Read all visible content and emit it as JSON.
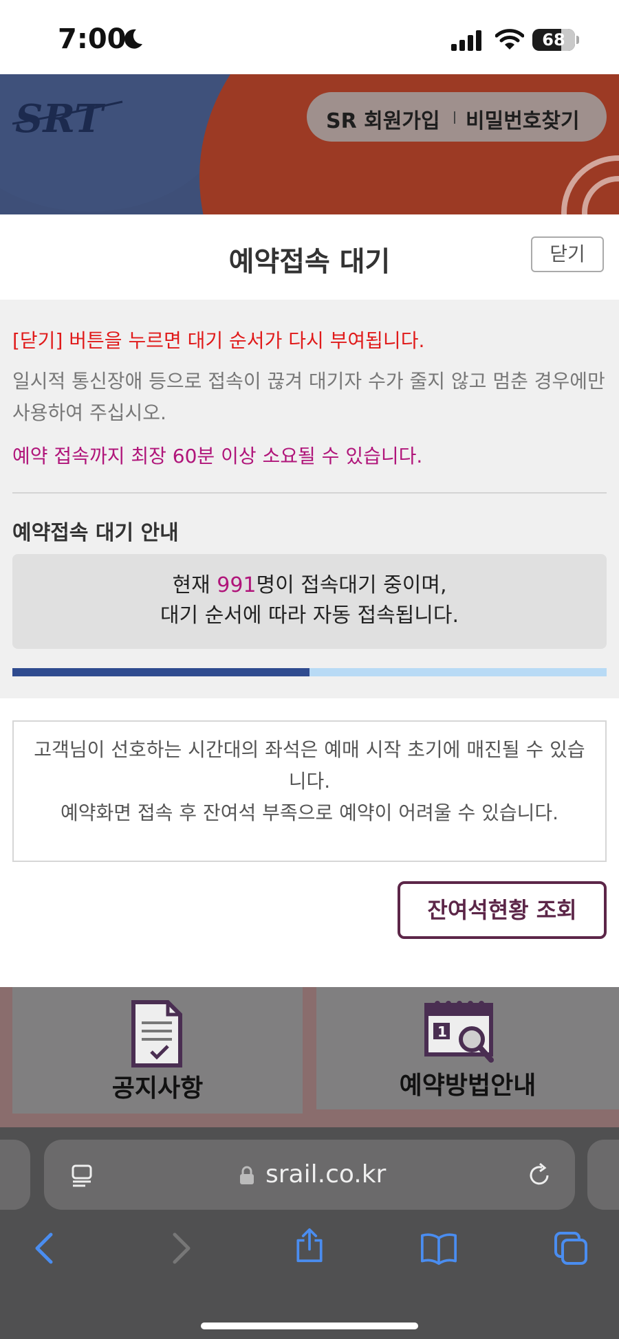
{
  "status_bar": {
    "time": "7:00",
    "battery": "68",
    "battery_level": 0.68,
    "icons": [
      "moon-icon",
      "signal-icon",
      "wifi-icon",
      "battery-icon"
    ]
  },
  "header": {
    "logo_text": "SRT",
    "signup": "SR 회원가입",
    "find_password": "비밀번호찾기"
  },
  "title_bar": {
    "title": "예약접속 대기",
    "close": "닫기"
  },
  "notices": {
    "red": "[닫기] 버튼을 누르면 대기 순서가 다시 부여됩니다.",
    "grey": "일시적 통신장애 등으로 접속이 끊겨 대기자 수가 줄지 않고 멈춘 경우에만 사용하여 주십시오.",
    "magenta": "예약 접속까지 최장 60분 이상 소요될 수 있습니다."
  },
  "queue": {
    "section_title": "예약접속 대기 안내",
    "prefix": "현재 ",
    "count": "991",
    "suffix": "명이 접속대기 중이며,",
    "line2": "대기 순서에 따라 자동 접속됩니다.",
    "progress": 0.5
  },
  "seat_notice": {
    "line1": "고객님이 선호하는 시간대의 좌석은 예매 시작 초기에 매진될 수 있습니다.",
    "line2": "예약화면 접속 후 잔여석 부족으로 예약이 어려울 수 있습니다."
  },
  "remaining_seats_button": "잔여석현황 조회",
  "quick_menu": [
    {
      "label": "공지사항",
      "icon": "notice-doc-icon"
    },
    {
      "label": "예약방법안내",
      "icon": "calendar-search-icon"
    }
  ],
  "browser": {
    "url": "srail.co.kr",
    "icons": [
      "reader-icon",
      "lock-icon",
      "reload-icon",
      "back-icon",
      "forward-icon",
      "share-icon",
      "bookmarks-icon",
      "tabs-icon"
    ]
  },
  "colors": {
    "accent_red": "#e01a1a",
    "accent_magenta": "#b0157a",
    "button_border": "#5c2648",
    "progress_fill": "#2f4b8f",
    "progress_track": "#b8daf5",
    "ios_blue": "#4a8df0"
  }
}
